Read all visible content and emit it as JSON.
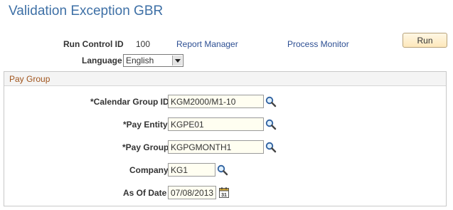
{
  "header": {
    "title": "Validation Exception GBR"
  },
  "run_control": {
    "label": "Run Control ID",
    "value": "100",
    "report_manager": "Report Manager",
    "process_monitor": "Process Monitor",
    "run_button": "Run"
  },
  "language": {
    "label": "Language",
    "value": "English"
  },
  "pay_group_section": {
    "title": "Pay Group",
    "fields": {
      "calendar_group": {
        "label": "*Calendar Group ID",
        "value": "KGM2000/M1-10"
      },
      "pay_entity": {
        "label": "*Pay Entity",
        "value": "KGPE01"
      },
      "pay_group": {
        "label": "*Pay Group",
        "value": "KGPGMONTH1"
      },
      "company": {
        "label": "Company",
        "value": "KG1"
      },
      "as_of_date": {
        "label": "As Of Date",
        "value": "07/08/2013"
      }
    }
  },
  "colors": {
    "title": "#3e70a6",
    "link": "#2d4f93",
    "section_title": "#a0541c",
    "input_bg": "#fffef1",
    "run_button_bg": "#fde8bb"
  },
  "icons": {
    "lookup": "magnifier-icon",
    "calendar": "calendar-icon"
  }
}
